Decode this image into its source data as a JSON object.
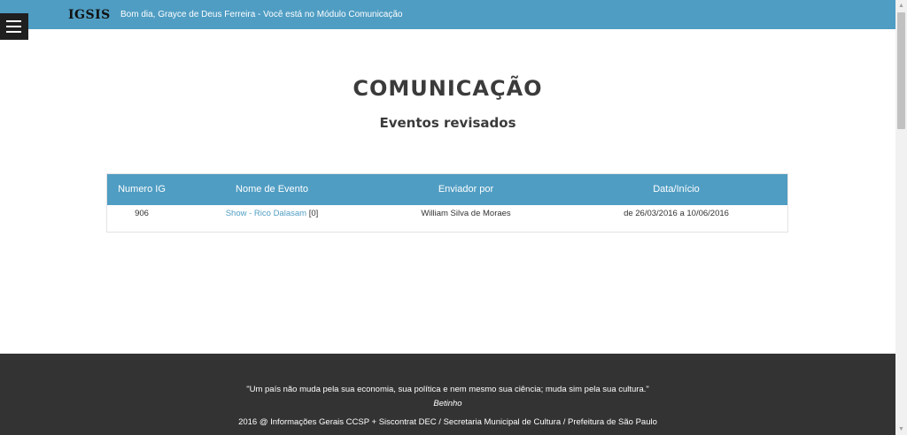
{
  "header": {
    "brand": "IGSIS",
    "greeting": "Bom dia, Grayce de Deus Ferreira - Você está no Módulo Comunicação",
    "menu_icon": "hamburger-menu-icon",
    "bar_color": "#4f9dc3"
  },
  "main": {
    "title": "COMUNICAÇÃO",
    "subtitle": "Eventos revisados"
  },
  "table": {
    "columns": [
      "Numero IG",
      "Nome de Evento",
      "Enviador por",
      "Data/Início"
    ],
    "rows": [
      {
        "numero_ig": "906",
        "evento_link": "Show - Rico Dalasam",
        "evento_suffix": " [0]",
        "enviador": "William Silva de Moraes",
        "data": "de 26/03/2016 a 10/06/2016"
      }
    ]
  },
  "footer": {
    "quote": "\"Um país não muda pela sua economia, sua política e nem mesmo sua ciência; muda sim pela sua cultura.\"",
    "author": "Betinho",
    "copyright": "2016 @ Informações Gerais CCSP + Siscontrat DEC / Secretaria Municipal de Cultura / Prefeitura de São Paulo",
    "background_color": "#333333"
  },
  "scrollbar": {
    "up_icon": "scroll-up-arrow-icon",
    "down_icon": "scroll-down-arrow-icon"
  }
}
